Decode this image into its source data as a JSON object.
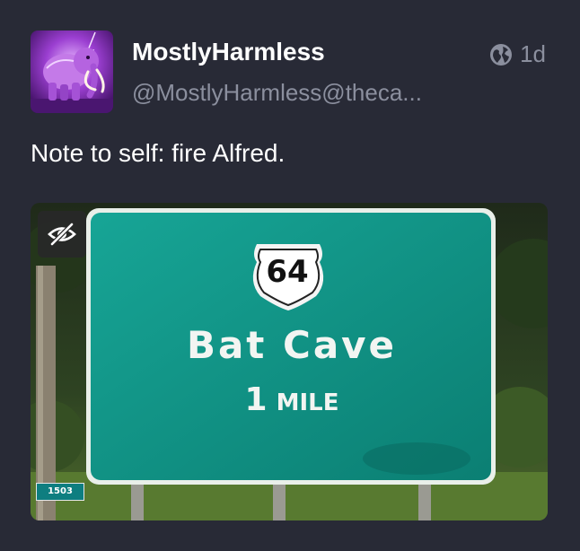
{
  "post": {
    "author": {
      "display_name": "MostlyHarmless",
      "handle": "@MostlyHarmless@theca..."
    },
    "visibility_icon": "globe-icon",
    "timestamp": "1d",
    "content": "Note to self: fire Alfred.",
    "media": {
      "hide_icon": "eye-slash-icon",
      "sign": {
        "route_number": "64",
        "destination": "Bat Cave",
        "distance_number": "1",
        "distance_unit": "MILE",
        "plate_number": "1503"
      }
    }
  },
  "colors": {
    "background": "#282a36",
    "text": "#ffffff",
    "muted": "#8b8f9e",
    "sign_green": "#0e7e80"
  }
}
